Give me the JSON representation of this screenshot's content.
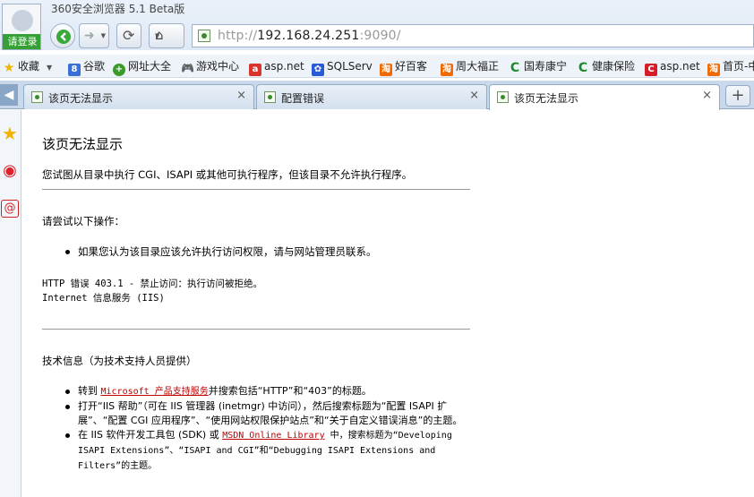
{
  "app": {
    "title": "360安全浏览器 5.1 Beta版",
    "login_label": "请登录"
  },
  "address": {
    "scheme": "http://",
    "host": "192.168.24.251",
    "port_path": ":9090/"
  },
  "bookmarks": [
    {
      "label": "收藏",
      "icon": "star-icon",
      "color": "#f0b400"
    },
    {
      "label": "谷歌",
      "icon": "google-icon",
      "color": "#3b6fd8"
    },
    {
      "label": "网址大全",
      "icon": "plus-green-icon",
      "color": "#3a9a2a"
    },
    {
      "label": "游戏中心",
      "icon": "gamepad-icon",
      "color": "#555555"
    },
    {
      "label": "asp.net",
      "icon": "site-icon",
      "color": "#d9342b"
    },
    {
      "label": "SQLServ",
      "icon": "paw-icon",
      "color": "#2a5bd7"
    },
    {
      "label": "好百客",
      "icon": "taobao-icon",
      "color": "#f06a00"
    },
    {
      "label": "周大福正",
      "icon": "taobao-icon",
      "color": "#f06a00"
    },
    {
      "label": "国寿康宁",
      "icon": "c-green-icon",
      "color": "#1e8a2e"
    },
    {
      "label": "健康保险",
      "icon": "c-green-icon",
      "color": "#1e8a2e"
    },
    {
      "label": "asp.net",
      "icon": "c-red-icon",
      "color": "#d21f2a"
    },
    {
      "label": "首页-中",
      "icon": "taobao-icon",
      "color": "#f06a00"
    }
  ],
  "tabs": [
    {
      "label": "该页无法显示",
      "close": "×"
    },
    {
      "label": "配置错误",
      "close": "×"
    },
    {
      "label": "该页无法显示",
      "close": "×"
    }
  ],
  "newtab_label": "+",
  "page": {
    "title": "该页无法显示",
    "intro": "您试图从目录中执行 CGI、ISAPI 或其他可执行程序，但该目录不允许执行程序。",
    "try_heading": "请尝试以下操作：",
    "try_items": [
      "如果您认为该目录应该允许执行访问权限，请与网站管理员联系。"
    ],
    "error_line1": "HTTP 错误 403.1 - 禁止访问：执行访问被拒绝。",
    "error_line2": "Internet 信息服务 (IIS)",
    "tech_heading": "技术信息（为技术支持人员提供）",
    "tech1_prefix": "转到 ",
    "tech1_link": "Microsoft 产品支持服务",
    "tech1_suffix": "并搜索包括“HTTP”和“403”的标题。",
    "tech2": "打开“IIS 帮助”（可在 IIS 管理器 (inetmgr) 中访问），然后搜索标题为“配置 ISAPI 扩展”、“配置 CGI 应用程序”、“使用网站权限保护站点”和“关于自定义错误消息”的主题。",
    "tech3_prefix": "在 IIS 软件开发工具包 (SDK) 或 ",
    "tech3_link": "MSDN Online Library",
    "tech3_suffix": " 中，搜索标题为“Developing ISAPI Extensions”、“ISAPI and CGI”和“Debugging ISAPI Extensions and Filters”的主题。"
  }
}
